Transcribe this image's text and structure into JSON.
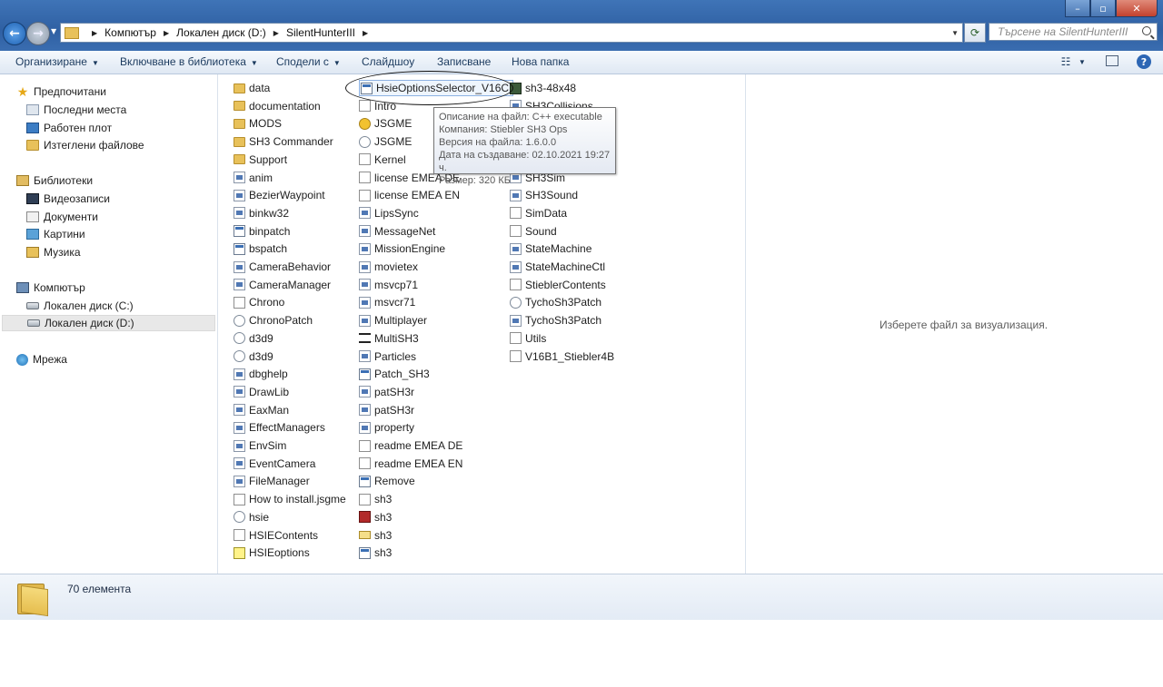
{
  "address": {
    "crumbs": [
      "Компютър",
      "Локален диск (D:)",
      "SilentHunterIII"
    ],
    "search_placeholder": "Търсене на SilentHunterIII"
  },
  "toolbar": {
    "organize": "Организиране",
    "include": "Включване в библиотека",
    "share": "Сподели с",
    "slideshow": "Слайдшоу",
    "burn": "Записване",
    "new_folder": "Нова папка"
  },
  "nav": {
    "favorites": "Предпочитани",
    "recent": "Последни места",
    "desktop": "Работен плот",
    "downloads": "Изтеглени файлове",
    "libraries": "Библиотеки",
    "videos": "Видеозаписи",
    "documents": "Документи",
    "pictures": "Картини",
    "music": "Музика",
    "computer": "Компютър",
    "drive_c": "Локален диск (C:)",
    "drive_d": "Локален диск (D:)",
    "network": "Мрежа"
  },
  "files": {
    "col1": [
      {
        "name": "data",
        "icon": "folder-icon"
      },
      {
        "name": "documentation",
        "icon": "folder-icon"
      },
      {
        "name": "MODS",
        "icon": "folder-icon"
      },
      {
        "name": "SH3 Commander",
        "icon": "folder-icon"
      },
      {
        "name": "Support",
        "icon": "folder-icon"
      },
      {
        "name": "anim",
        "icon": "dll-icon"
      },
      {
        "name": "BezierWaypoint",
        "icon": "dll-icon"
      },
      {
        "name": "binkw32",
        "icon": "dll-icon"
      },
      {
        "name": "binpatch",
        "icon": "exe-icon"
      },
      {
        "name": "bspatch",
        "icon": "exe-icon"
      },
      {
        "name": "CameraBehavior",
        "icon": "dll-icon"
      },
      {
        "name": "CameraManager",
        "icon": "dll-icon"
      },
      {
        "name": "Chrono",
        "icon": "text-file-icon"
      },
      {
        "name": "ChronoPatch",
        "icon": "config-icon"
      },
      {
        "name": "d3d9",
        "icon": "config-icon"
      },
      {
        "name": "d3d9",
        "icon": "config-icon"
      },
      {
        "name": "dbghelp",
        "icon": "dll-icon"
      },
      {
        "name": "DrawLib",
        "icon": "dll-icon"
      },
      {
        "name": "EaxMan",
        "icon": "dll-icon"
      },
      {
        "name": "EffectManagers",
        "icon": "dll-icon"
      },
      {
        "name": "EnvSim",
        "icon": "dll-icon"
      },
      {
        "name": "EventCamera",
        "icon": "dll-icon"
      },
      {
        "name": "FileManager",
        "icon": "dll-icon"
      },
      {
        "name": "How to install.jsgme",
        "icon": "text-file-icon"
      },
      {
        "name": "hsie",
        "icon": "config-icon"
      },
      {
        "name": "HSIEContents",
        "icon": "text-file-icon"
      },
      {
        "name": "HSIEoptions",
        "icon": "help-file-icon"
      }
    ],
    "col2": [
      {
        "name": "HsieOptionsSelector_V16C",
        "icon": "exe-icon"
      },
      {
        "name": "Intro",
        "icon": "text-file-icon"
      },
      {
        "name": "JSGME",
        "icon": "jsgme-icon"
      },
      {
        "name": "JSGME",
        "icon": "config-icon"
      },
      {
        "name": "Kernel",
        "icon": "text-file-icon"
      },
      {
        "name": "license EMEA DE",
        "icon": "text-file-icon"
      },
      {
        "name": "license EMEA EN",
        "icon": "text-file-icon"
      },
      {
        "name": "LipsSync",
        "icon": "dll-icon"
      },
      {
        "name": "MessageNet",
        "icon": "dll-icon"
      },
      {
        "name": "MissionEngine",
        "icon": "dll-icon"
      },
      {
        "name": "movietex",
        "icon": "dll-icon"
      },
      {
        "name": "msvcp71",
        "icon": "dll-icon"
      },
      {
        "name": "msvcr71",
        "icon": "dll-icon"
      },
      {
        "name": "Multiplayer",
        "icon": "dll-icon"
      },
      {
        "name": "MultiSH3",
        "icon": "multi-icon"
      },
      {
        "name": "Particles",
        "icon": "dll-icon"
      },
      {
        "name": "Patch_SH3",
        "icon": "exe-icon"
      },
      {
        "name": "patSH3r",
        "icon": "dll-icon"
      },
      {
        "name": "patSH3r",
        "icon": "dll-icon"
      },
      {
        "name": "property",
        "icon": "dll-icon"
      },
      {
        "name": "readme EMEA DE",
        "icon": "text-file-icon"
      },
      {
        "name": "readme EMEA EN",
        "icon": "text-file-icon"
      },
      {
        "name": "Remove",
        "icon": "exe-icon"
      },
      {
        "name": "sh3",
        "icon": "text-file-icon"
      },
      {
        "name": "sh3",
        "icon": "red-image-icon"
      },
      {
        "name": "sh3",
        "icon": "mail-icon"
      },
      {
        "name": "sh3",
        "icon": "exe-icon"
      }
    ],
    "col3": [
      {
        "name": "sh3-48x48",
        "icon": "sub-icon"
      },
      {
        "name": "SH3Collisions",
        "icon": "dll-icon"
      },
      {
        "name": "",
        "icon": "dll-icon"
      },
      {
        "name": "",
        "icon": "dll-icon"
      },
      {
        "name": "",
        "icon": "dll-icon"
      },
      {
        "name": "SH3Sim",
        "icon": "dll-icon"
      },
      {
        "name": "SH3Sound",
        "icon": "dll-icon"
      },
      {
        "name": "SimData",
        "icon": "text-file-icon"
      },
      {
        "name": "Sound",
        "icon": "text-file-icon"
      },
      {
        "name": "StateMachine",
        "icon": "dll-icon"
      },
      {
        "name": "StateMachineCtl",
        "icon": "dll-icon"
      },
      {
        "name": "StieblerContents",
        "icon": "text-file-icon"
      },
      {
        "name": "TychoSh3Patch",
        "icon": "config-icon"
      },
      {
        "name": "TychoSh3Patch",
        "icon": "dll-icon"
      },
      {
        "name": "Utils",
        "icon": "text-file-icon"
      },
      {
        "name": "V16B1_Stiebler4B",
        "icon": "text-file-icon"
      }
    ]
  },
  "tooltip": {
    "line1": "Описание на файл: C++ executable",
    "line2": "Компания: Stiebler SH3 Ops",
    "line3": "Версия на файла: 1.6.0.0",
    "line4": "Дата на създаване: 02.10.2021 19:27 ч.",
    "line5": "Размер: 320 КБ"
  },
  "preview": {
    "text": "Изберете файл за визуализация."
  },
  "status": {
    "count": "70 елемента"
  }
}
